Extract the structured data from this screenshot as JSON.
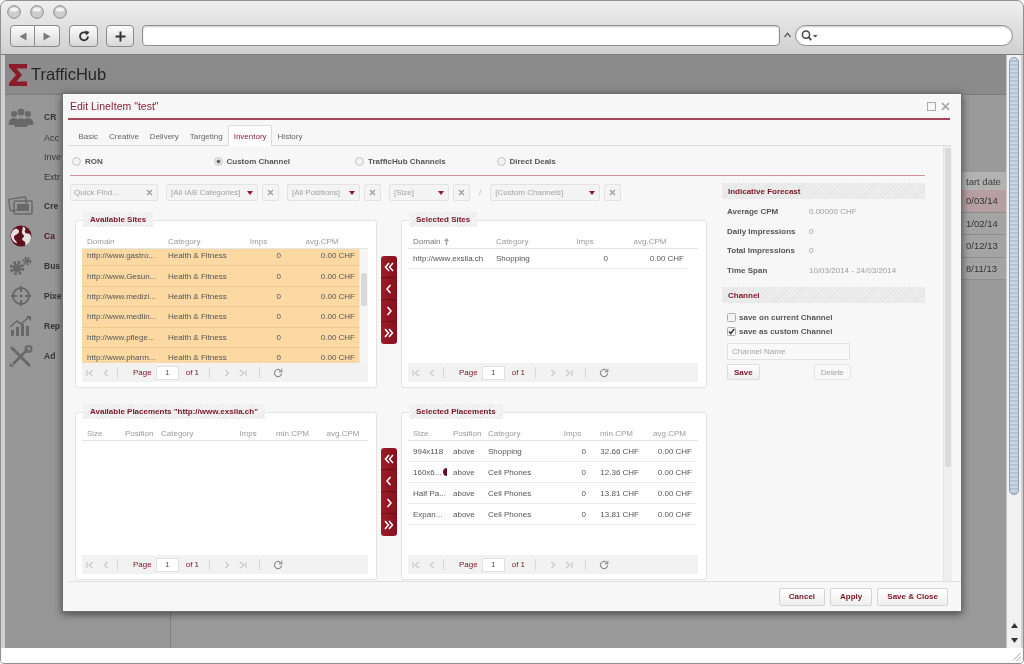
{
  "app": {
    "logo": "TrafficHub"
  },
  "sidebar": {
    "items": [
      {
        "label": "CR",
        "selected": false,
        "children": [
          {
            "label": "Acc",
            "selected": false
          },
          {
            "label": "Inve",
            "selected": false
          },
          {
            "label": "Extr",
            "selected": false
          }
        ]
      },
      {
        "label": "Cre",
        "selected": false
      },
      {
        "label": "Ca",
        "selected": true
      },
      {
        "label": "Bus",
        "selected": false
      },
      {
        "label": "Pixe",
        "selected": false
      },
      {
        "label": "Rep",
        "selected": false
      },
      {
        "label": "Ad",
        "selected": false
      }
    ]
  },
  "background_table": {
    "column": "tart date",
    "rows": [
      {
        "value": "0/03/14",
        "selected": true
      },
      {
        "value": "1/02/14",
        "selected": false
      },
      {
        "value": "0/12/13",
        "selected": false
      },
      {
        "value": "8/11/13",
        "selected": false
      }
    ]
  },
  "dialog": {
    "title": "Edit LineItem \"test\"",
    "tabs": [
      {
        "label": "Basic",
        "selected": false
      },
      {
        "label": "Creative",
        "selected": false
      },
      {
        "label": "Delivery",
        "selected": false
      },
      {
        "label": "Targeting",
        "selected": false
      },
      {
        "label": "Inventory",
        "selected": true
      },
      {
        "label": "History",
        "selected": false
      }
    ],
    "inventory_types": [
      {
        "label": "RON",
        "selected": false
      },
      {
        "label": "Custom Channel",
        "selected": true
      },
      {
        "label": "TrafficHub Channels",
        "selected": false
      },
      {
        "label": "Direct Deals",
        "selected": false
      }
    ],
    "filters": [
      {
        "kind": "search",
        "placeholder": "Quick Find..."
      },
      {
        "kind": "dropdown",
        "placeholder": "[All IAB Categories]"
      },
      {
        "kind": "dropdown",
        "placeholder": "[All Positions]"
      },
      {
        "kind": "dropdown",
        "placeholder": "[Size]"
      },
      {
        "kind": "separator",
        "text": "/"
      },
      {
        "kind": "dropdown",
        "placeholder": "[Custom Channels]"
      }
    ],
    "available_sites": {
      "title": "Available Sites",
      "columns": [
        {
          "label": "Domain",
          "sorted": false
        },
        {
          "label": "Category",
          "sorted": false
        },
        {
          "label": "Imps",
          "sorted": false
        },
        {
          "label": "avg.CPM",
          "sorted": false
        }
      ],
      "rows": [
        {
          "cells": [
            "http://www.gastro...",
            "Health & Fitness",
            "0",
            "0.00 CHF"
          ],
          "selected": true
        },
        {
          "cells": [
            "http://www.Gesun...",
            "Health & Fitness",
            "0",
            "0.00 CHF"
          ],
          "selected": true
        },
        {
          "cells": [
            "http://www.medizi...",
            "Health & Fitness",
            "0",
            "0.00 CHF"
          ],
          "selected": true
        },
        {
          "cells": [
            "http://www.medlin...",
            "Health & Fitness",
            "0",
            "0.00 CHF"
          ],
          "selected": true
        },
        {
          "cells": [
            "http://www.pflege...",
            "Health & Fitness",
            "0",
            "0.00 CHF"
          ],
          "selected": true
        },
        {
          "cells": [
            "http://www.pharm...",
            "Health & Fitness",
            "0",
            "0.00 CHF"
          ],
          "selected": true
        }
      ],
      "pager": {
        "label": "Page",
        "page": "1",
        "total": "of 1",
        "nav_disabled": true
      }
    },
    "selected_sites": {
      "title": "Selected Sites",
      "columns": [
        {
          "label": "Domain",
          "sorted": true
        },
        {
          "label": "Category",
          "sorted": false
        },
        {
          "label": "Imps",
          "sorted": false
        },
        {
          "label": "avg.CPM",
          "sorted": false
        }
      ],
      "rows": [
        {
          "cells": [
            "http://www.exsila.ch",
            "Shopping",
            "0",
            "0.00 CHF"
          ],
          "selected": false
        }
      ],
      "pager": {
        "label": "Page",
        "page": "1",
        "total": "of 1",
        "nav_disabled": true
      }
    },
    "available_placements": {
      "title": "Available Placements \"http://www.exsila.ch\"",
      "columns": [
        {
          "label": "Size",
          "sorted": false
        },
        {
          "label": "Position",
          "sorted": false
        },
        {
          "label": "Category",
          "sorted": false
        },
        {
          "label": "Imps",
          "sorted": false
        },
        {
          "label": "min.CPM",
          "sorted": false
        },
        {
          "label": "avg.CPM",
          "sorted": false
        }
      ],
      "pager": {
        "label": "Page",
        "page": "1",
        "total": "of 1",
        "nav_disabled": true
      }
    },
    "selected_placements": {
      "title": "Selected Placements",
      "columns": [
        {
          "label": "Size",
          "sorted": false
        },
        {
          "label": "Position",
          "sorted": false
        },
        {
          "label": "Category",
          "sorted": false
        },
        {
          "label": "Imps",
          "sorted": false
        },
        {
          "label": "min.CPM",
          "sorted": false
        },
        {
          "label": "avg.CPM",
          "sorted": false
        }
      ],
      "rows": [
        {
          "cells": [
            "994x118",
            "above",
            "Shopping",
            "0",
            "32.66 CHF",
            "0.00 CHF"
          ],
          "selected": false,
          "marked": false
        },
        {
          "cells": [
            "160x6...",
            "above",
            "Cell Phones",
            "0",
            "12.36 CHF",
            "0.00 CHF"
          ],
          "selected": false,
          "marked": true
        },
        {
          "cells": [
            "Half Pa...",
            "above",
            "Cell Phones",
            "0",
            "13.81 CHF",
            "0.00 CHF"
          ],
          "selected": false,
          "marked": false
        },
        {
          "cells": [
            "Expan...",
            "above",
            "Cell Phones",
            "0",
            "13.81 CHF",
            "0.00 CHF"
          ],
          "selected": false,
          "marked": false
        }
      ],
      "pager": {
        "label": "Page",
        "page": "1",
        "total": "of 1",
        "nav_disabled": true
      }
    },
    "forecast": {
      "title": "Indicative Forecast",
      "rows": [
        {
          "label": "Average CPM",
          "value": "0.00000 CHF"
        },
        {
          "label": "Daily Impressions",
          "value": "0"
        },
        {
          "label": "Total Impressions",
          "value": "0"
        },
        {
          "label": "Time Span",
          "value": "10/03/2014 - 24/03/2014"
        }
      ]
    },
    "channel": {
      "title": "Channel",
      "options": [
        {
          "label": "save on current Channel",
          "checked": false
        },
        {
          "label": "save as custom Channel",
          "checked": true
        }
      ],
      "name_field": {
        "placeholder": "Channel Name"
      },
      "buttons": [
        {
          "label": "Save",
          "disabled": false
        },
        {
          "label": "Delete",
          "disabled": true
        }
      ]
    },
    "buttons": [
      "Cancel",
      "Apply",
      "Save & Close"
    ]
  }
}
